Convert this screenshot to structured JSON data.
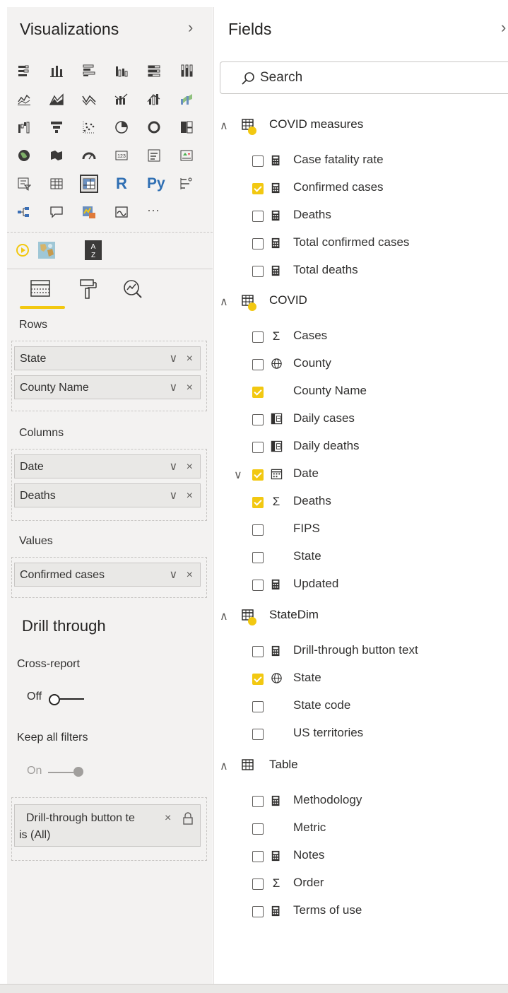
{
  "visualizations": {
    "title": "Visualizations",
    "collapse_glyph": "›",
    "gallery_icons": [
      "stacked-bar-icon",
      "stacked-column-icon",
      "clustered-bar-icon",
      "clustered-column-icon",
      "100pct-bar-icon",
      "100pct-column-icon",
      "line-chart-icon",
      "area-chart-icon",
      "stacked-area-icon",
      "line-column-icon",
      "line-clustered-column-icon",
      "ribbon-chart-icon",
      "waterfall-icon",
      "funnel-icon",
      "scatter-icon",
      "pie-icon",
      "donut-icon",
      "treemap-icon",
      "map-icon",
      "filled-map-icon",
      "gauge-icon",
      "card-icon",
      "multirow-card-icon",
      "kpi-icon",
      "slicer-icon",
      "table-icon",
      "matrix-icon",
      "r-visual-icon",
      "python-visual-icon",
      "key-influencers-icon",
      "decomposition-tree-icon",
      "qa-icon",
      "smart-narrative-icon",
      "paginated-report-icon",
      "more-icon"
    ],
    "more_label": "···",
    "r_label": "R",
    "py_label": "Py",
    "tabs": [
      "fields-tab-icon",
      "format-tab-icon",
      "analytics-tab-icon"
    ],
    "rows_label": "Rows",
    "rows": [
      "State",
      "County Name"
    ],
    "columns_label": "Columns",
    "columns": [
      "Date",
      "Deaths"
    ],
    "values_label": "Values",
    "values": [
      "Confirmed cases"
    ],
    "well_controls": "∨ ×",
    "drill": {
      "title": "Drill through",
      "cross_report_label": "Cross-report",
      "cross_report_state": "Off",
      "keep_filters_label": "Keep all filters",
      "keep_filters_state": "On",
      "filter_text": "Drill-through button te",
      "filter_value": "is (All)",
      "filter_close": "×"
    }
  },
  "fields": {
    "title": "Fields",
    "collapse_glyph": "›",
    "search_placeholder": "Search",
    "tables": [
      {
        "name": "COVID measures",
        "expand": "∧",
        "items": [
          {
            "name": "Case fatality rate",
            "icon": "▦",
            "checked": false
          },
          {
            "name": "Confirmed cases",
            "icon": "▦",
            "checked": true
          },
          {
            "name": "Deaths",
            "icon": "▦",
            "checked": false
          },
          {
            "name": "Total confirmed cases",
            "icon": "▦",
            "checked": false
          },
          {
            "name": "Total deaths",
            "icon": "▦",
            "checked": false
          }
        ]
      },
      {
        "name": "COVID",
        "expand": "∧",
        "items": [
          {
            "name": "Cases",
            "icon": "Σ",
            "checked": false
          },
          {
            "name": "County",
            "icon": "⊕",
            "checked": false
          },
          {
            "name": "County Name",
            "icon": "",
            "checked": true
          },
          {
            "name": "Daily cases",
            "icon": "◫",
            "checked": false
          },
          {
            "name": "Daily deaths",
            "icon": "◫",
            "checked": false
          },
          {
            "name": "Date",
            "icon": "▦",
            "checked": true,
            "expand": "∨"
          },
          {
            "name": "Deaths",
            "icon": "Σ",
            "checked": true
          },
          {
            "name": "FIPS",
            "icon": "",
            "checked": false
          },
          {
            "name": "State",
            "icon": "",
            "checked": false
          },
          {
            "name": "Updated",
            "icon": "▦",
            "checked": false
          }
        ]
      },
      {
        "name": "StateDim",
        "expand": "∧",
        "items": [
          {
            "name": "Drill-through button text",
            "icon": "▦",
            "checked": false
          },
          {
            "name": "State",
            "icon": "⊕",
            "checked": true
          },
          {
            "name": "State code",
            "icon": "",
            "checked": false
          },
          {
            "name": "US territories",
            "icon": "",
            "checked": false
          }
        ]
      },
      {
        "name": "Table",
        "expand": "∧",
        "items": [
          {
            "name": "Methodology",
            "icon": "▦",
            "checked": false
          },
          {
            "name": "Metric",
            "icon": "",
            "checked": false
          },
          {
            "name": "Notes",
            "icon": "▦",
            "checked": false
          },
          {
            "name": "Order",
            "icon": "Σ",
            "checked": false
          },
          {
            "name": "Terms of use",
            "icon": "▦",
            "checked": false
          }
        ]
      }
    ]
  },
  "colors": {
    "accent": "#f2c811",
    "pane_bg": "#f3f2f1",
    "pill_bg": "#e9e8e6",
    "text": "#252423",
    "icon": "#3b3a39"
  }
}
